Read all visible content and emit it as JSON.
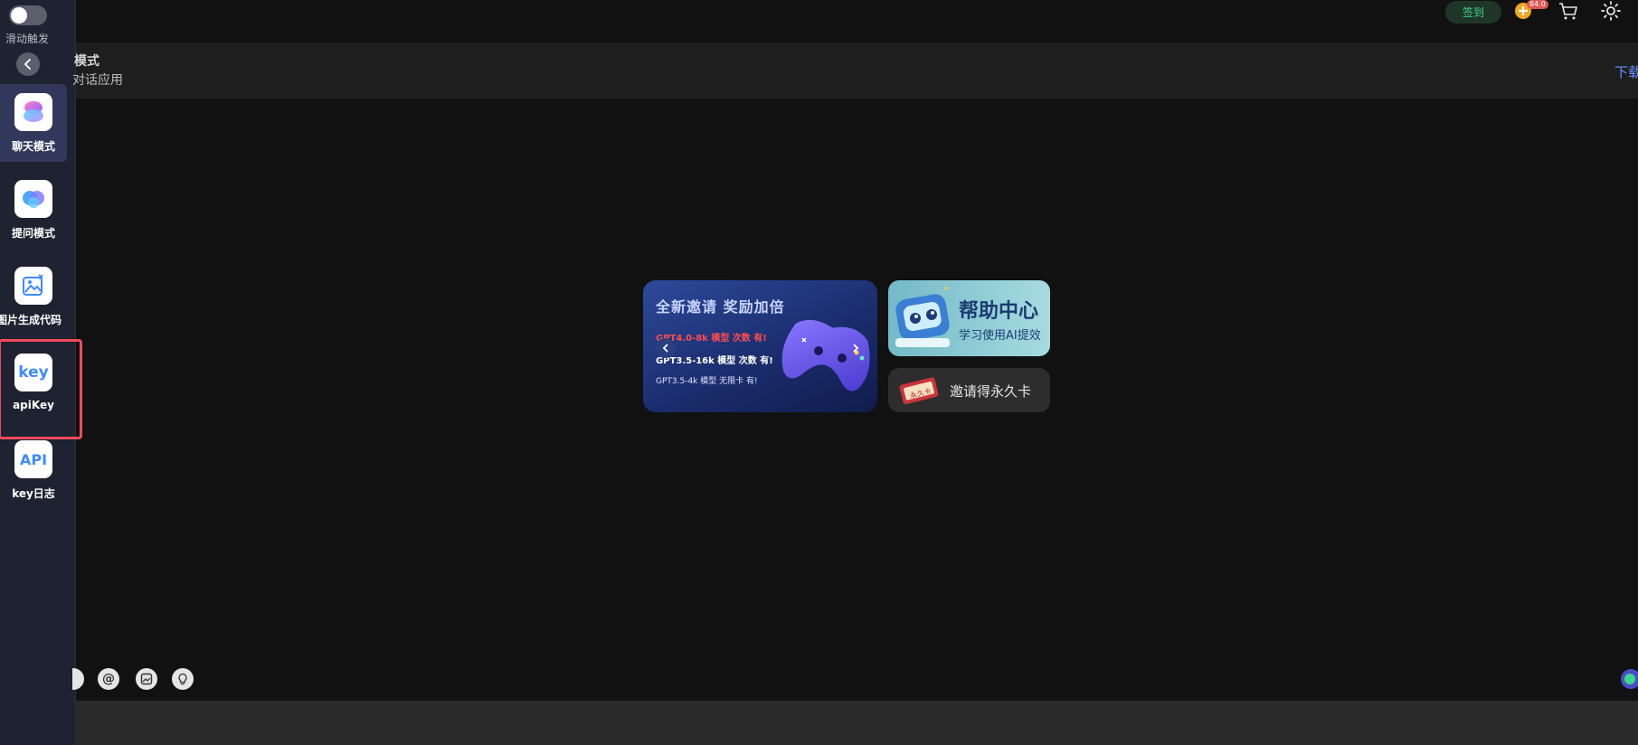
{
  "sidebar": {
    "toggle_label": "滑动触发",
    "items": [
      {
        "label": "聊天模式",
        "icon": "chat-mode-icon"
      },
      {
        "label": "提问模式",
        "icon": "ask-mode-icon"
      },
      {
        "label": "图片生成代码",
        "icon": "image-to-code-icon"
      },
      {
        "label": "apiKey",
        "icon": "key-icon",
        "icon_text": "key"
      },
      {
        "label": "key日志",
        "icon": "api-log-icon",
        "icon_text": "API"
      }
    ]
  },
  "topbar": {
    "signin_label": "签到",
    "coin_badge": "84.0"
  },
  "mode_header": {
    "title": "模式",
    "desc": "对话应用",
    "download": "下载"
  },
  "banner_main": {
    "title": "全新邀请 奖励加倍",
    "line1": "GPT4.0-8k 模型 次数 有!",
    "line2": "GPT3.5-16k 模型 次数 有!",
    "line3": "GPT3.5-4k 模型 无限卡 有!"
  },
  "banner_help": {
    "title": "帮助中心",
    "subtitle": "学习使用AI提效"
  },
  "banner_invite": {
    "label": "邀请得永久卡",
    "ticket_text": "永久卡"
  },
  "colors": {
    "accent_green": "#3dd68c",
    "link_blue": "#6c8dff",
    "highlight_red": "#ee4b5c"
  }
}
